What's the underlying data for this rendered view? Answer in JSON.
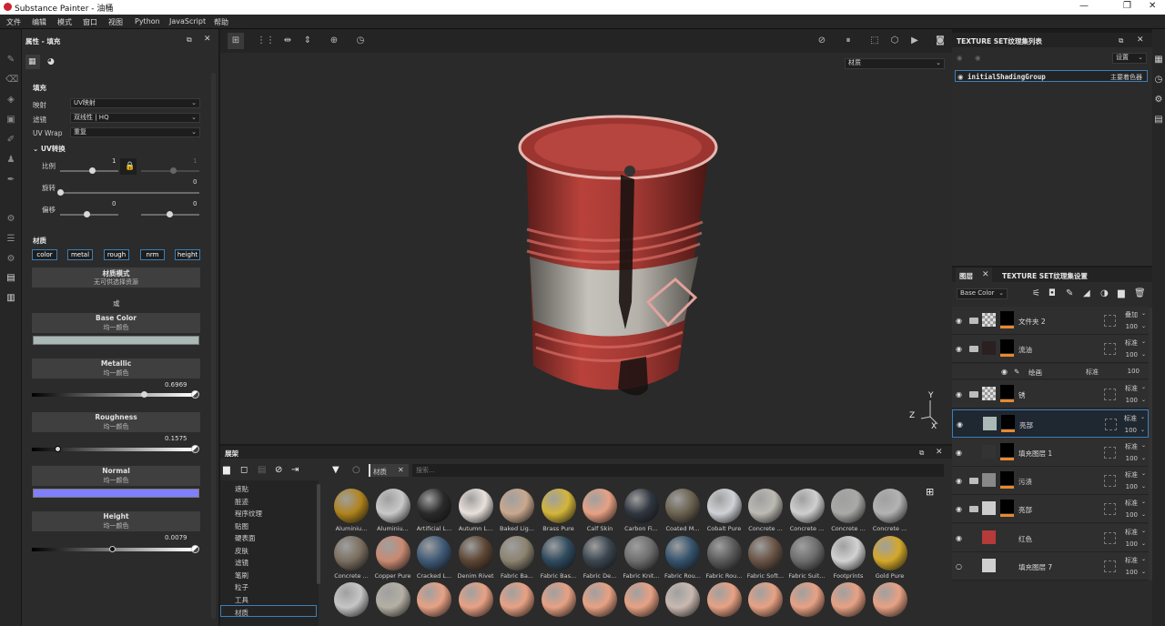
{
  "window": {
    "title": "Substance Painter - 油桶"
  },
  "menu": [
    "文件",
    "编辑",
    "模式",
    "窗口",
    "视图",
    "Python",
    "JavaScript",
    "帮助"
  ],
  "properties": {
    "header": "属性 - 填充",
    "section_fill": "填充",
    "mapping_label": "映射",
    "mapping_value": "UV映射",
    "filter_label": "滤镜",
    "filter_value": "双线性 | HQ",
    "uvwrap_label": "UV Wrap",
    "uvwrap_value": "重复",
    "uv_transform": "UV转换",
    "scale_label": "比例",
    "scale_value": "1",
    "scale_value2": "1",
    "rotate_label": "旋转",
    "rotate_value": "0",
    "offset_label": "偏移",
    "offset_value": "0",
    "offset_value2": "0",
    "section_material": "材质",
    "channels": [
      "color",
      "metal",
      "rough",
      "nrm",
      "height"
    ],
    "material_mode_title": "材质模式",
    "material_mode_sub": "无可供选择资源",
    "or_label": "或",
    "base_color": {
      "name": "Base Color",
      "sub": "均一颜色",
      "swatch": "#aab9b5"
    },
    "metallic": {
      "name": "Metallic",
      "sub": "均一颜色",
      "value": "0.6969",
      "fraction": 0.6969
    },
    "roughness": {
      "name": "Roughness",
      "sub": "均一颜色",
      "value": "0.1575",
      "fraction": 0.1575
    },
    "normal": {
      "name": "Normal",
      "sub": "均一颜色",
      "swatch": "#8080ff"
    },
    "height": {
      "name": "Height",
      "sub": "均一颜色",
      "value": "0.0079",
      "fraction": 0.5
    }
  },
  "viewport": {
    "material_dropdown": "材质",
    "axis_y": "Y",
    "axis_z": "Z",
    "axis_x": "X"
  },
  "shelf": {
    "title": "展架",
    "filter_tag": "材质",
    "search_placeholder": "搜索...",
    "categories": [
      "遮贴",
      "脏迹",
      "程序纹理",
      "贴图",
      "硬表面",
      "皮肤",
      "滤镜",
      "笔刷",
      "粒子",
      "工具",
      "材质"
    ],
    "selected_category": "材质",
    "rows": [
      [
        {
          "name": "Aluminiu...",
          "color": "#b0841e"
        },
        {
          "name": "Aluminiu...",
          "color": "#c9c9c9"
        },
        {
          "name": "Artificial L...",
          "color": "#2a2a2a"
        },
        {
          "name": "Autumn L...",
          "color": "#e8e0da"
        },
        {
          "name": "Baked Lig...",
          "color": "#c9a88e"
        },
        {
          "name": "Brass Pure",
          "color": "#d3b53a"
        },
        {
          "name": "Calf Skin",
          "color": "#e7a184"
        },
        {
          "name": "Carbon Fi...",
          "color": "#303640"
        },
        {
          "name": "Coated M...",
          "color": "#6b6250"
        },
        {
          "name": "Cobalt Pure",
          "color": "#cfd2d6"
        },
        {
          "name": "Concrete ...",
          "color": "#bdbab3"
        },
        {
          "name": "Concrete ...",
          "color": "#cfcfcf"
        },
        {
          "name": "Concrete ...",
          "color": "#a9a9a7"
        },
        {
          "name": "Concrete ...",
          "color": "#b3b3b3"
        }
      ],
      [
        {
          "name": "Concrete ...",
          "color": "#7b6f60"
        },
        {
          "name": "Copper Pure",
          "color": "#c98a72"
        },
        {
          "name": "Cracked L...",
          "color": "#3f5a77"
        },
        {
          "name": "Denim Rivet",
          "color": "#5d4634"
        },
        {
          "name": "Fabric Ba...",
          "color": "#8c8370"
        },
        {
          "name": "Fabric Bas...",
          "color": "#2f4a5e"
        },
        {
          "name": "Fabric De...",
          "color": "#3b4650"
        },
        {
          "name": "Fabric Knit...",
          "color": "#6e6e6e"
        },
        {
          "name": "Fabric Rou...",
          "color": "#35536d"
        },
        {
          "name": "Fabric Rou...",
          "color": "#5a5a5a"
        },
        {
          "name": "Fabric Soft...",
          "color": "#6a5446"
        },
        {
          "name": "Fabric Suit...",
          "color": "#6d6d6d"
        },
        {
          "name": "Footprints",
          "color": "#d2d2d2"
        },
        {
          "name": "Gold Pure",
          "color": "#d4a82a"
        }
      ],
      [
        {
          "name": "",
          "color": "#c6c6c6"
        },
        {
          "name": "",
          "color": "#b5b0a5"
        },
        {
          "name": "",
          "color": "#e7a184"
        },
        {
          "name": "",
          "color": "#e7a184"
        },
        {
          "name": "",
          "color": "#e7a184"
        },
        {
          "name": "",
          "color": "#e7a184"
        },
        {
          "name": "",
          "color": "#e7a184"
        },
        {
          "name": "",
          "color": "#e7a184"
        },
        {
          "name": "",
          "color": "#c9b9b0"
        },
        {
          "name": "",
          "color": "#e7a184"
        },
        {
          "name": "",
          "color": "#e7a184"
        },
        {
          "name": "",
          "color": "#e7a184"
        },
        {
          "name": "",
          "color": "#e7a184"
        },
        {
          "name": "",
          "color": "#e7a184"
        }
      ]
    ]
  },
  "texture_sets": {
    "title": "TEXTURE SET纹理集列表",
    "settings_button": "设置",
    "set_name": "initialShadingGroup",
    "set_shader": "主要着色器"
  },
  "layers": {
    "tab_layers": "图层",
    "tab_settings": "TEXTURE SET纹理集设置",
    "channel": "Base Color",
    "items": [
      {
        "name": "文件夹 2",
        "blend": "叠加",
        "opacity": "100",
        "folder": true,
        "thumb": "checker"
      },
      {
        "name": "流油",
        "blend": "标准",
        "opacity": "100",
        "folder": true,
        "thumb": "#2a2020"
      },
      {
        "name": "锈",
        "blend": "标准",
        "opacity": "100",
        "folder": true,
        "thumb": "checker"
      },
      {
        "name": "亮部",
        "blend": "标准",
        "opacity": "100",
        "folder": false,
        "thumb": "#aab9b5"
      },
      {
        "name": "填充图层 1",
        "blend": "标准",
        "opacity": "100",
        "folder": false,
        "thumb": "#333333"
      },
      {
        "name": "污渍",
        "blend": "标准",
        "opacity": "100",
        "folder": true,
        "thumb": "#888888"
      },
      {
        "name": "亮部",
        "blend": "标准",
        "opacity": "100",
        "folder": true,
        "thumb": "#cccccc"
      },
      {
        "name": "红色",
        "blend": "标准",
        "opacity": "100",
        "folder": false,
        "thumb": "#b53a3a"
      },
      {
        "name": "填充图层 7",
        "blend": "标准",
        "opacity": "100",
        "folder": false,
        "thumb": "#cfcfcf"
      }
    ],
    "effect": {
      "name": "绘画",
      "blend": "标准",
      "opacity": "100"
    }
  }
}
